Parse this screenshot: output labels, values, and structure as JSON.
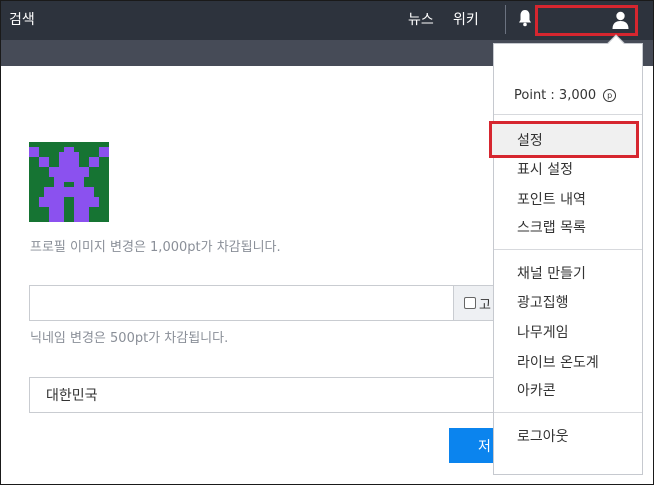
{
  "navbar": {
    "search_label": "검색",
    "news_label": "뉴스",
    "wiki_label": "위키"
  },
  "profile": {
    "image_help": "프로필 이미지 변경은 1,000pt가 차감됩니다.",
    "nickname_value": "",
    "nickname_addon": "고",
    "nickname_help": "닉네임 변경은 500pt가 차감됩니다.",
    "country_value": "대한민국",
    "submit_label": "저"
  },
  "dropdown": {
    "point_text": "Point : 3,000",
    "point_symbol": "p",
    "settings": "설정",
    "display_settings": "표시 설정",
    "point_history": "포인트 내역",
    "scrap_list": "스크랩 목록",
    "create_channel": "채널 만들기",
    "ad_execution": "광고집행",
    "namu_game": "나무게임",
    "live_thermometer": "라이브 온도계",
    "arcacon": "아카콘",
    "logout": "로그아웃"
  },
  "colors": {
    "navbar_bg": "#2d333d",
    "subbar_bg": "#464b57",
    "accent_blue": "#0b84ee",
    "highlight_red": "#d6262f",
    "avatar_green": "#167433",
    "avatar_purple": "#8b51ef"
  }
}
